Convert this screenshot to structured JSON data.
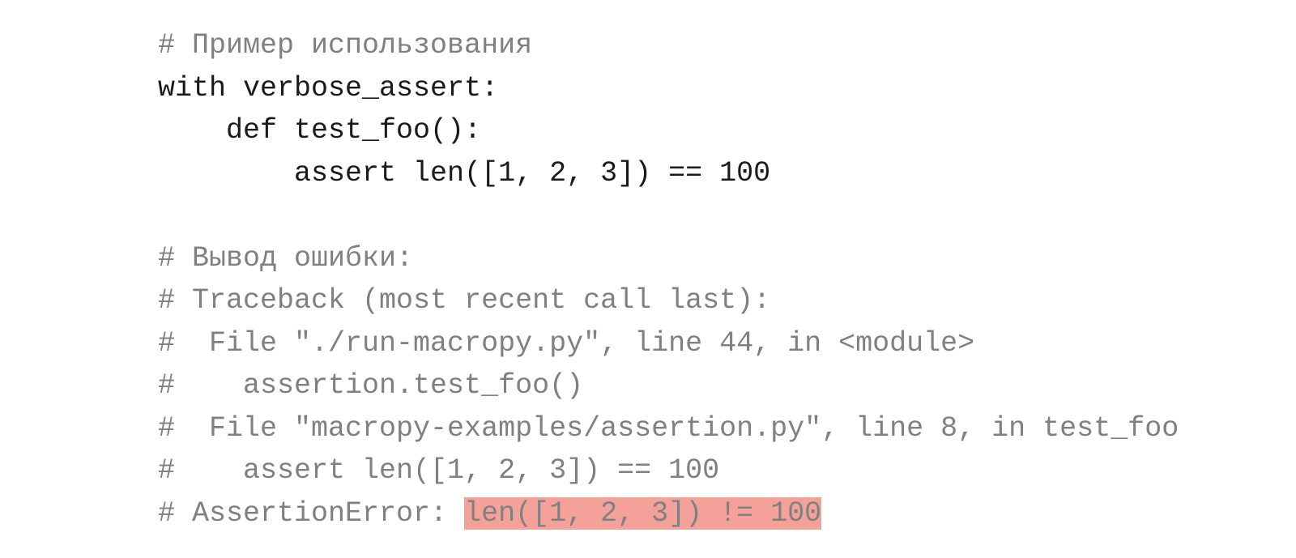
{
  "lines": {
    "l1": "# Пример использования",
    "l2": "with verbose_assert:",
    "l3": "    def test_foo():",
    "l4": "        assert len([1, 2, 3]) == 100",
    "l5": "",
    "l6": "# Вывод ошибки:",
    "l7": "# Traceback (most recent call last):",
    "l8": "#  File \"./run-macropy.py\", line 44, in <module>",
    "l9": "#    assertion.test_foo()",
    "l10": "#  File \"macropy-examples/assertion.py\", line 8, in test_foo",
    "l11": "#    assert len([1, 2, 3]) == 100",
    "l12a": "# AssertionError: ",
    "l12b": "len([1, 2, 3]) != 100"
  },
  "colors": {
    "comment": "#808080",
    "code": "#1a1a1a",
    "highlight_bg": "#f4a19a"
  }
}
